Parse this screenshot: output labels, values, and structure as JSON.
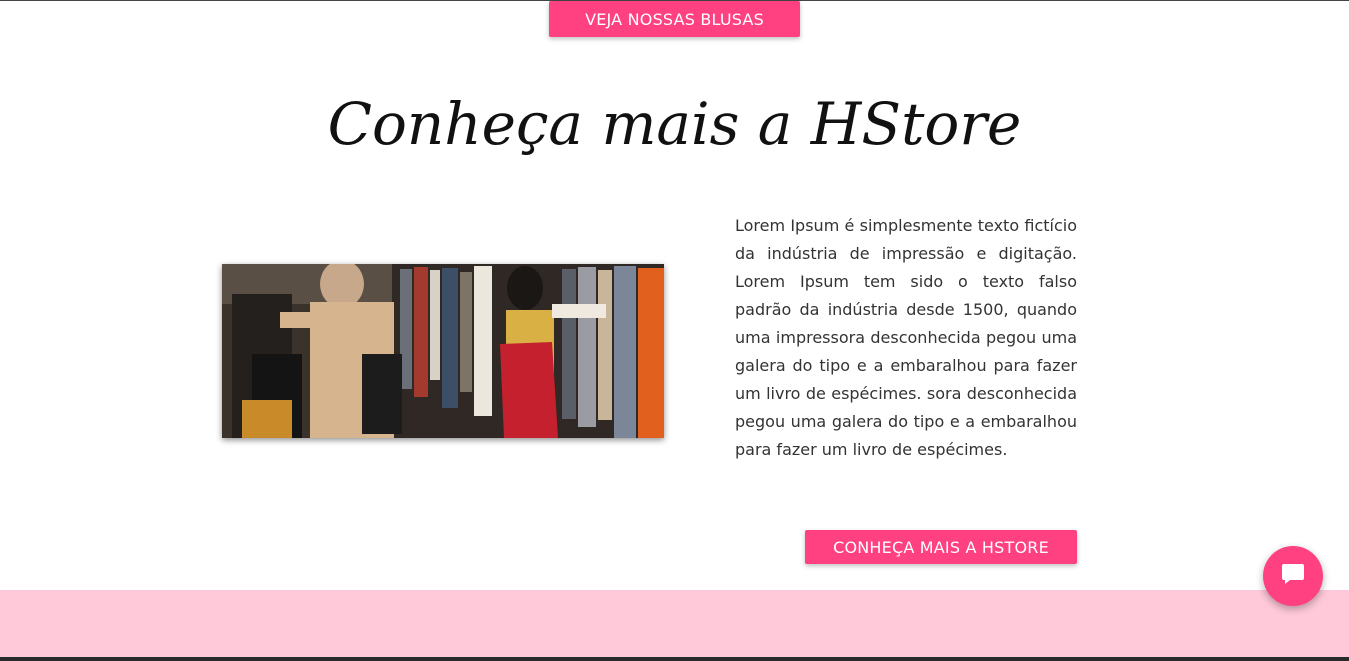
{
  "buttons": {
    "top_label": "VEJA NOSSAS BLUSAS",
    "more_label": "CONHEÇA MAIS A HSTORE"
  },
  "section": {
    "title": "Conheça mais a HStore",
    "paragraph": "Lorem Ipsum é simplesmente texto fictício da indústria de impressão e digitação. Lorem Ipsum tem sido o texto falso padrão da indústria desde 1500, quando uma impressora desconhecida pegou uma galera do tipo e a embaralhou para fazer um livro de espécimes. sora desconhecida pegou uma galera do tipo e a embaralhou para fazer um livro de espécimes."
  },
  "image": {
    "subject": "clothing-store-shoppers-photo"
  },
  "chat": {
    "icon": "chat-bubble-icon"
  },
  "colors": {
    "accent": "#ff4081",
    "band": "#ffc9d9",
    "text": "#333333"
  }
}
